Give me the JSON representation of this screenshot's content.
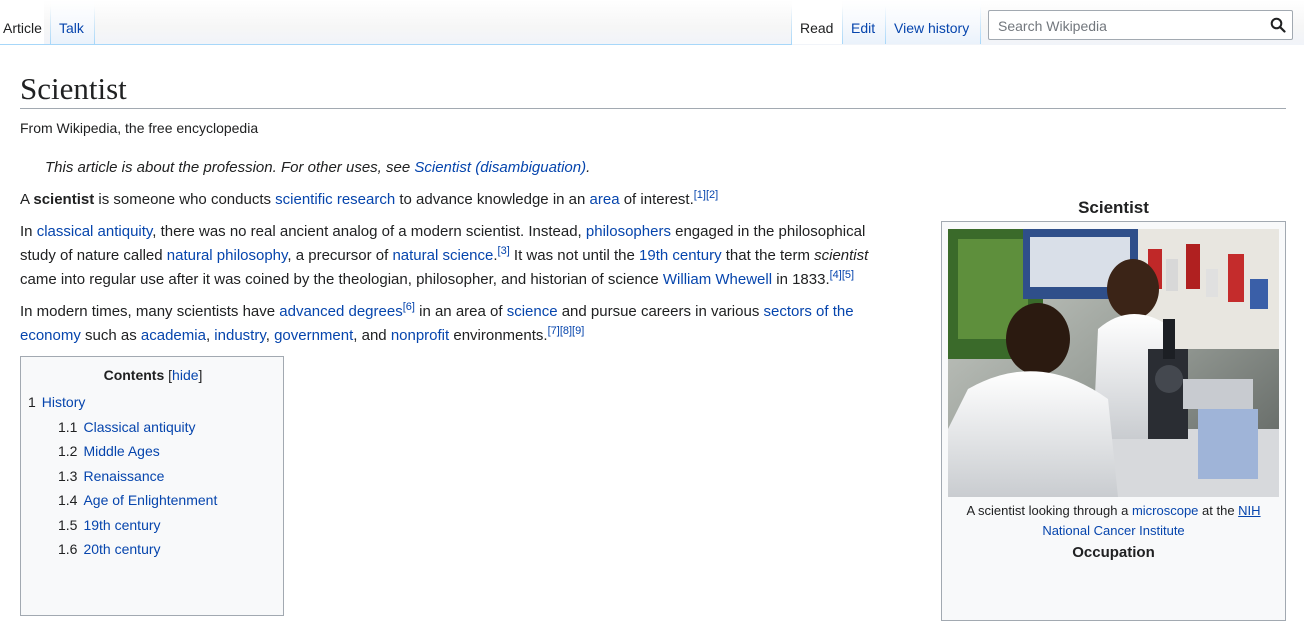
{
  "tabs": {
    "left": [
      "Article",
      "Talk"
    ],
    "right": [
      "Read",
      "Edit",
      "View history"
    ]
  },
  "search": {
    "placeholder": "Search Wikipedia",
    "icon": "search-icon"
  },
  "page": {
    "title": "Scientist",
    "tagline": "From Wikipedia, the free encyclopedia",
    "hatnote": {
      "text": "This article is about the profession. For other uses, see ",
      "link": "Scientist (disambiguation)",
      "end": "."
    }
  },
  "paragraphs": {
    "p1": [
      "A ",
      "scientist",
      " is someone who conducts ",
      "scientific research",
      " to advance knowledge in an ",
      "area",
      " of interest.",
      "[1]",
      "[2]"
    ],
    "p2": [
      "In ",
      "classical antiquity",
      ", there was no real ancient analog of a modern scientist. Instead, ",
      "philosophers",
      " engaged in the philosophical study of nature called ",
      "natural philosophy",
      ", a precursor of ",
      "natural science",
      ".",
      "[3]",
      " It was not until the ",
      "19th century",
      " that the term ",
      "scientist",
      " came into regular use after it was coined by the theologian, philosopher, and historian of science ",
      "William Whewell",
      " in 1833.",
      "[4]",
      "[5]"
    ],
    "p3": [
      "In modern times, many scientists have ",
      "advanced degrees",
      "[6]",
      " in an area of ",
      "science",
      " and pursue careers in various ",
      "sectors of the economy",
      " such as ",
      "academia",
      ", ",
      "industry",
      ", ",
      "government",
      ", and ",
      "nonprofit",
      " environments.",
      "[7]",
      "[8]",
      "[9]"
    ]
  },
  "toc": {
    "title": "Contents",
    "toggle": "hide",
    "items": [
      {
        "num": "1",
        "label": "History"
      },
      {
        "num": "1.1",
        "label": "Classical antiquity"
      },
      {
        "num": "1.2",
        "label": "Middle Ages"
      },
      {
        "num": "1.3",
        "label": "Renaissance"
      },
      {
        "num": "1.4",
        "label": "Age of Enlightenment"
      },
      {
        "num": "1.5",
        "label": "19th century"
      },
      {
        "num": "1.6",
        "label": "20th century"
      }
    ]
  },
  "infobox": {
    "title": "Scientist",
    "caption_pre": "A scientist looking through a ",
    "caption_link1": "microscope",
    "caption_mid": " at the ",
    "caption_link2": "NIH",
    "caption_link3": "National Cancer Institute",
    "subheading": "Occupation"
  },
  "colors": {
    "link": "#0645ad",
    "text": "#202122",
    "border": "#a2a9b1",
    "tab_border": "#a7d7f9"
  }
}
